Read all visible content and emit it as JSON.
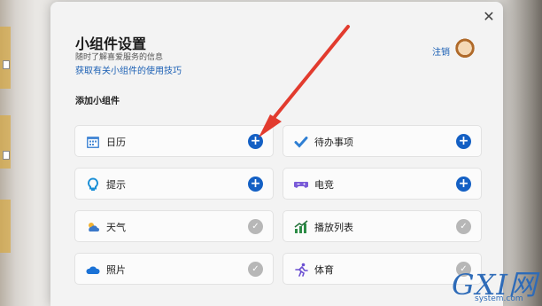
{
  "window": {
    "title": "小组件设置",
    "subtitle": "随时了解喜爱服务的信息",
    "help_link": "获取有关小组件的使用技巧",
    "sign_out": "注销",
    "close_glyph": "✕"
  },
  "section_title": "添加小组件",
  "widgets": [
    {
      "label": "日历",
      "icon": "calendar-icon",
      "state": "add"
    },
    {
      "label": "待办事项",
      "icon": "checkmark-icon",
      "state": "add"
    },
    {
      "label": "提示",
      "icon": "lightbulb-icon",
      "state": "add"
    },
    {
      "label": "电竞",
      "icon": "gamepad-icon",
      "state": "add"
    },
    {
      "label": "天气",
      "icon": "weather-icon",
      "state": "added"
    },
    {
      "label": "播放列表",
      "icon": "chart-icon",
      "state": "added"
    },
    {
      "label": "照片",
      "icon": "cloud-icon",
      "state": "added"
    },
    {
      "label": "体育",
      "icon": "runner-icon",
      "state": "added"
    }
  ],
  "glyphs": {
    "add": "+",
    "added": "✓"
  },
  "colors": {
    "accent": "#1460c4",
    "arrow": "#e23b2e",
    "added": "#b7b7b7"
  },
  "watermark": {
    "main": "GXI网",
    "sub": "system.com"
  }
}
